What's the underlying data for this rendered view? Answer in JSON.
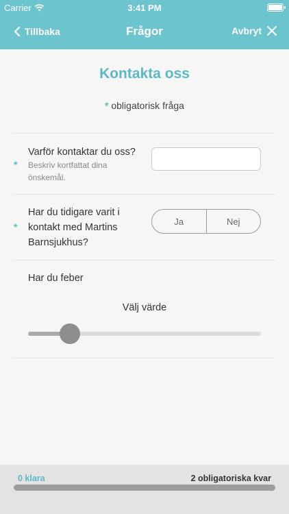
{
  "status": {
    "carrier": "Carrier",
    "time": "3:41 PM"
  },
  "nav": {
    "back_label": "Tillbaka",
    "title": "Frågor",
    "cancel_label": "Avbryt"
  },
  "form": {
    "title": "Kontakta oss",
    "required_marker": "*",
    "required_note": "obligatorisk fråga",
    "questions": [
      {
        "label": "Varför kontaktar du oss?",
        "hint_line1": "Beskriv kortfattat dina",
        "hint_line2": "önskemål.",
        "required": true,
        "value": "",
        "placeholder": ""
      },
      {
        "label_line1": "Har du tidigare varit i",
        "label_line2": "kontakt med Martins",
        "label_line3": "Barnsjukhus?",
        "required": true,
        "options": [
          "Ja",
          "Nej"
        ],
        "selected": null
      },
      {
        "label": "Har du feber",
        "required": false,
        "slider_label": "Välj värde",
        "slider_position": 0.18
      }
    ]
  },
  "progress": {
    "done_label": "0 klara",
    "remaining_label": "2 obligatoriska kvar",
    "fraction": 0
  },
  "colors": {
    "accent": "#5bb8c4",
    "header": "#6cc4cf"
  }
}
